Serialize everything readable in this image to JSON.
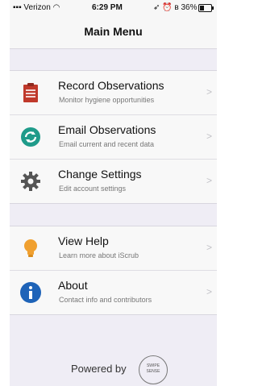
{
  "status_bar": {
    "carrier": "Verizon",
    "time": "6:29 PM",
    "battery": "36%"
  },
  "nav": {
    "title": "Main Menu"
  },
  "groups": [
    {
      "items": [
        {
          "icon": "clipboard-icon",
          "label": "Record Observations",
          "subtitle": "Monitor hygiene opportunities"
        },
        {
          "icon": "email-sync-icon",
          "label": "Email Observations",
          "subtitle": "Email current and recent data"
        },
        {
          "icon": "gear-icon",
          "label": "Change Settings",
          "subtitle": "Edit account settings"
        }
      ]
    },
    {
      "items": [
        {
          "icon": "lightbulb-icon",
          "label": "View Help",
          "subtitle": "Learn more about iScrub"
        },
        {
          "icon": "info-icon",
          "label": "About",
          "subtitle": "Contact info and contributors"
        }
      ]
    }
  ],
  "footer": {
    "powered_by": "Powered by",
    "logo_text_1": "SWIPE",
    "logo_text_2": "SENSE"
  },
  "colors": {
    "clipboard": "#c0392b",
    "sync": "#1f9b8a",
    "gear": "#555555",
    "bulb": "#f0a030",
    "info": "#1e63b8"
  }
}
